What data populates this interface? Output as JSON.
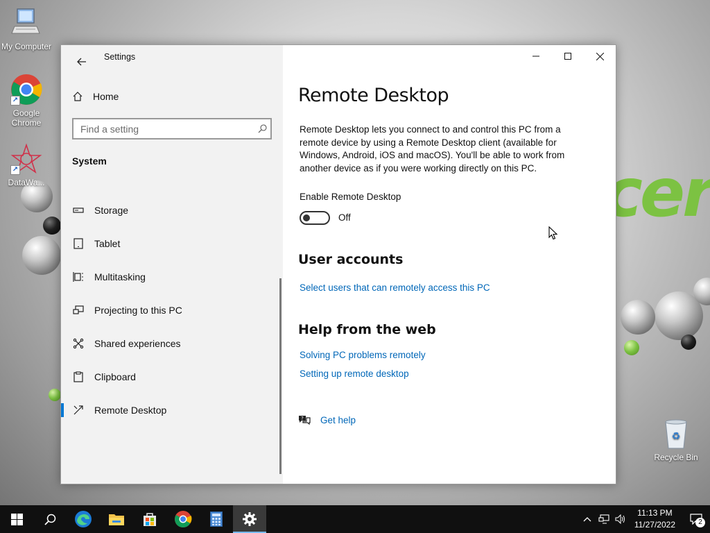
{
  "desktop": {
    "wallpaper_text": "cer",
    "icons": [
      {
        "label": "My Computer"
      },
      {
        "label": "Google Chrome"
      },
      {
        "label": "DataWa..."
      },
      {
        "label": "Recycle Bin"
      }
    ]
  },
  "window": {
    "title": "Settings",
    "controls": {
      "minimize": "minimize",
      "maximize": "maximize",
      "close": "close"
    }
  },
  "sidebar": {
    "home_label": "Home",
    "search": {
      "placeholder": "Find a setting",
      "value": ""
    },
    "section_title": "System",
    "items": [
      {
        "label": "Storage",
        "icon": "storage-icon"
      },
      {
        "label": "Tablet",
        "icon": "tablet-icon"
      },
      {
        "label": "Multitasking",
        "icon": "multitasking-icon"
      },
      {
        "label": "Projecting to this PC",
        "icon": "projecting-icon"
      },
      {
        "label": "Shared experiences",
        "icon": "shared-experiences-icon"
      },
      {
        "label": "Clipboard",
        "icon": "clipboard-icon"
      },
      {
        "label": "Remote Desktop",
        "icon": "remote-desktop-icon",
        "active": true
      }
    ]
  },
  "content": {
    "title": "Remote Desktop",
    "description": "Remote Desktop lets you connect to and control this PC from a remote device by using a Remote Desktop client (available for Windows, Android, iOS and macOS). You'll be able to work from another device as if you were working directly on this PC.",
    "toggle": {
      "label": "Enable Remote Desktop",
      "state": "Off",
      "on": false
    },
    "user_accounts": {
      "heading": "User accounts",
      "link": "Select users that can remotely access this PC"
    },
    "help": {
      "heading": "Help from the web",
      "links": [
        "Solving PC problems remotely",
        "Setting up remote desktop"
      ]
    },
    "get_help": "Get help"
  },
  "taskbar": {
    "apps": [
      "start",
      "search",
      "edge",
      "file-explorer",
      "store",
      "chrome",
      "calculator",
      "settings"
    ],
    "active_app": "settings",
    "clock": {
      "time": "11:13 PM",
      "date": "11/27/2022"
    },
    "notification_count": "2"
  },
  "colors": {
    "accent": "#0078d4",
    "link": "#0067b8",
    "sidebar_bg": "#f2f2f2",
    "taskbar_bg": "#101010"
  }
}
